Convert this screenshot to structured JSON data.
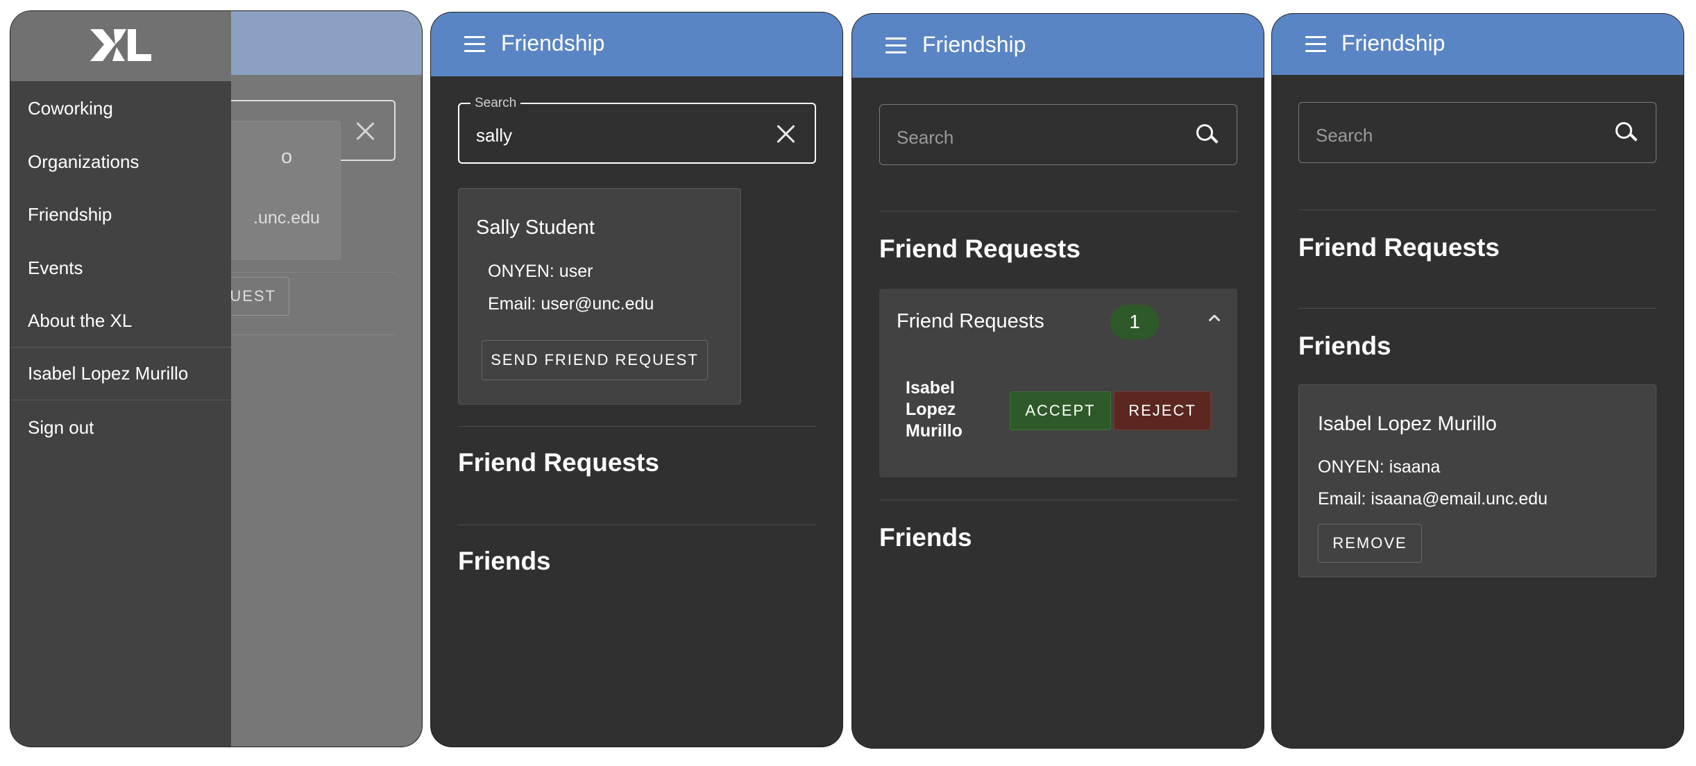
{
  "screens": {
    "drawer_screen": {
      "nav_items": [
        "Coworking",
        "Organizations",
        "Friendship",
        "Events",
        "About the XL"
      ],
      "user_name": "Isabel Lopez Murillo",
      "sign_out": "Sign out",
      "bg_card_fragment": "o",
      "bg_email_fragment": ".unc.edu",
      "bg_button_fragment": "UEST"
    },
    "search_results": {
      "title": "Friendship",
      "search_label": "Search",
      "search_value": "sally",
      "result": {
        "name": "Sally Student",
        "onyen": "ONYEN: user",
        "email": "Email: user@unc.edu",
        "button": "SEND FRIEND REQUEST"
      },
      "friend_requests_heading": "Friend Requests",
      "friends_heading": "Friends"
    },
    "requests_screen": {
      "title": "Friendship",
      "search_placeholder": "Search",
      "friend_requests_heading": "Friend Requests",
      "panel_title": "Friend Requests",
      "badge_count": "1",
      "request_name_lines": [
        "Isabel",
        "Lopez",
        "Murillo"
      ],
      "accept": "ACCEPT",
      "reject": "REJECT",
      "friends_heading": "Friends"
    },
    "friends_screen": {
      "title": "Friendship",
      "search_placeholder": "Search",
      "friend_requests_heading": "Friend Requests",
      "friends_heading": "Friends",
      "friend": {
        "name": "Isabel Lopez Murillo",
        "onyen": "ONYEN: isaana",
        "email": "Email: isaana@email.unc.edu",
        "button": "REMOVE"
      }
    }
  },
  "colors": {
    "app_bar": "#5a85c4",
    "background": "#303030",
    "card": "#424242",
    "accept": "#2e5a29",
    "reject": "#5b2720",
    "badge": "#2e5a29"
  },
  "icons": [
    "xl-logo",
    "menu-icon",
    "close-icon",
    "search-icon",
    "chevron-up-icon"
  ]
}
